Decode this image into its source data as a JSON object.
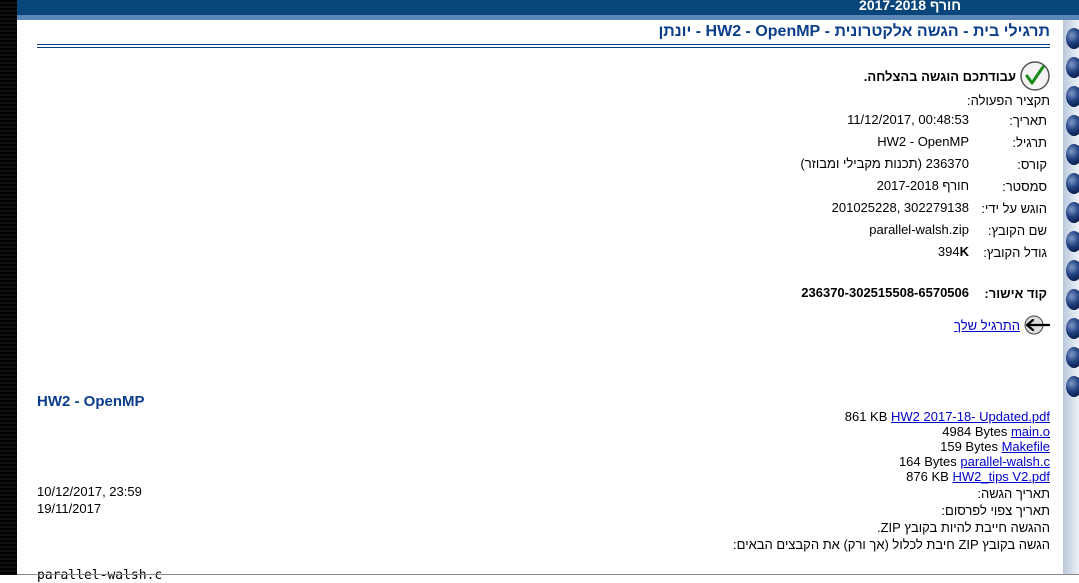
{
  "header": {
    "semester": "חורף 2017-2018",
    "page_title": "תרגילי בית - הגשה אלקטרונית - HW2 - OpenMP - יונתן"
  },
  "success": {
    "message": "עבודתכם הוגשה בהצלחה.",
    "icon": "check-icon"
  },
  "summary": {
    "title": "תקציר הפעולה:",
    "rows": [
      {
        "label": "תאריך:",
        "value": "11/12/2017, 00:48:53"
      },
      {
        "label": "תרגיל:",
        "value": "HW2 - OpenMP"
      },
      {
        "label": "קורס:",
        "value": "236370 (תכנות מקבילי ומבוזר)"
      },
      {
        "label": "סמסטר:",
        "value": "חורף 2017-2018"
      },
      {
        "label": "הוגש על ידי:",
        "value": "201025228, 302279138"
      },
      {
        "label": "שם הקובץ:",
        "value": "parallel-walsh.zip"
      },
      {
        "label": "גודל הקובץ:",
        "value_num": "394",
        "value_unit": "K"
      }
    ],
    "approval_label": "קוד אישור:",
    "approval_code": "236370-302515508-6570506"
  },
  "next_link": {
    "label": "התרגיל שלך",
    "icon": "back-arrow-icon"
  },
  "assignment": {
    "title": "HW2 - OpenMP",
    "files": [
      {
        "name": "HW2 2017-18- Updated.pdf",
        "size": "861 KB"
      },
      {
        "name": "main.o",
        "size": "4984 Bytes"
      },
      {
        "name": "Makefile",
        "size": "159 Bytes"
      },
      {
        "name": "parallel-walsh.c",
        "size": "164 Bytes"
      },
      {
        "name": "HW2_tips V2.pdf",
        "size": "876 KB"
      }
    ],
    "due_label": "תאריך הגשה:",
    "due_date": "10/12/2017, 23:59",
    "publish_label": "תאריך צפוי לפרסום:",
    "publish_date": "19/11/2017",
    "zip_note": "ההגשה חייבת להיות בקובץ ZIP.",
    "zip_contents_note": "הגשה בקובץ ZIP חיבת לכלול (אך ורק) את הקבצים הבאים:",
    "required_file": "parallel-walsh.c"
  },
  "colors": {
    "title_blue": "#0b3e8a",
    "header_band": "#08457a",
    "link_blue": "#0000cc"
  }
}
